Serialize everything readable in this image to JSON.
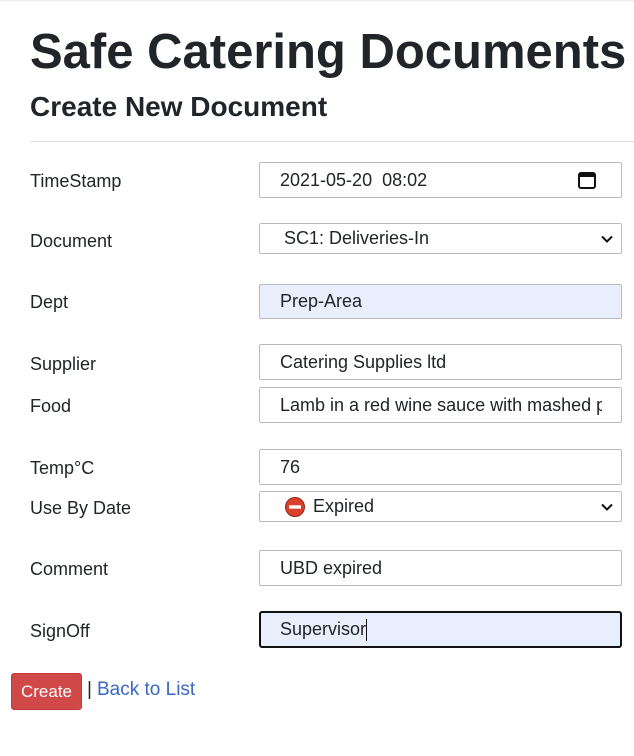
{
  "page": {
    "title": "Safe Catering Documents",
    "subtitle": "Create New Document"
  },
  "form": {
    "timestamp": {
      "label": "TimeStamp",
      "value": "2021-05-20  08:02",
      "icon": "calendar-icon"
    },
    "document": {
      "label": "Document",
      "value": "SC1: Deliveries-In",
      "icon": "chevron-down-icon"
    },
    "dept": {
      "label": "Dept",
      "value": "Prep-Area"
    },
    "supplier": {
      "label": "Supplier",
      "value": "Catering Supplies ltd"
    },
    "food": {
      "label": "Food",
      "value": "Lamb in a red wine sauce with mashed potato"
    },
    "temp": {
      "label": "Temp°C",
      "value": "76"
    },
    "use_by_date": {
      "label": "Use By Date",
      "value": "Expired",
      "icon": "no-entry-icon",
      "icon_color": "#d9412b"
    },
    "comment": {
      "label": "Comment",
      "value": "UBD expired"
    },
    "signoff": {
      "label": "SignOff",
      "value": "Supervisor"
    }
  },
  "actions": {
    "create_label": "Create",
    "separator": "|",
    "back_label": "Back to List"
  },
  "colors": {
    "create_button": "#d04848",
    "link": "#3a68c2",
    "autofill_background": "#e8eefc"
  }
}
